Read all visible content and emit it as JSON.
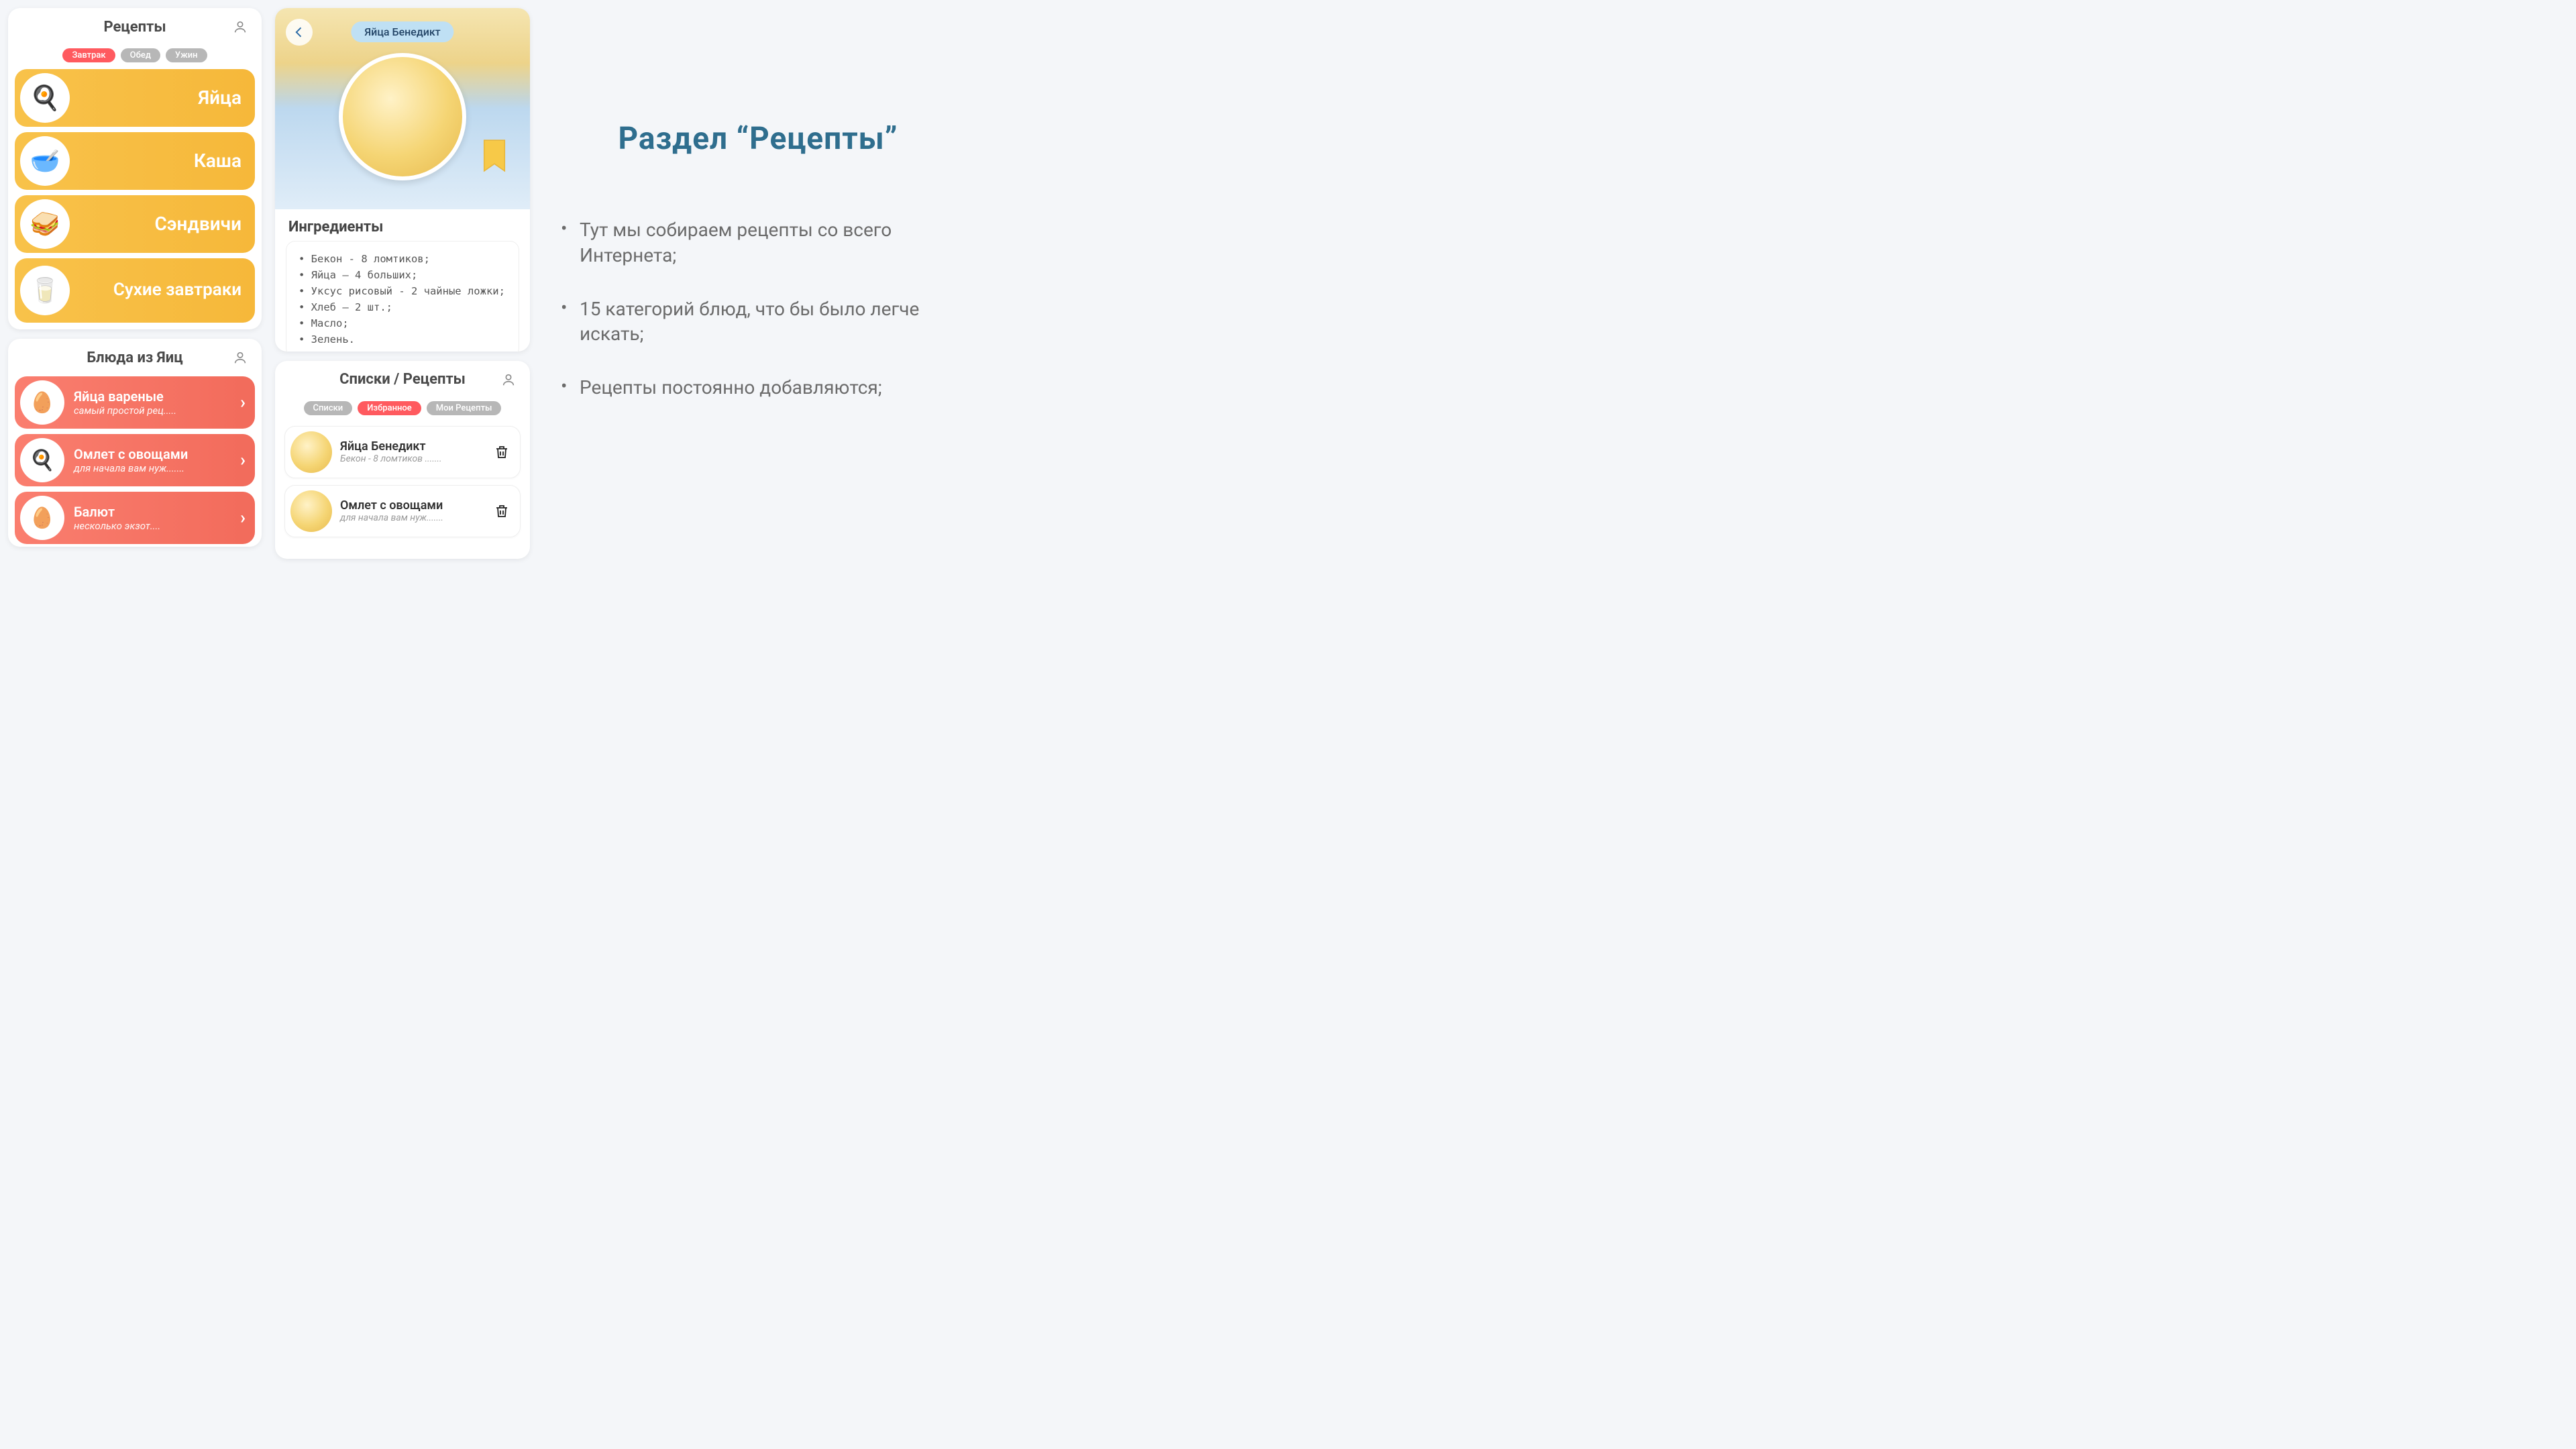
{
  "screens": {
    "recipes": {
      "title": "Рецепты",
      "filters": [
        {
          "label": "Завтрак",
          "active": true
        },
        {
          "label": "Обед",
          "active": false
        },
        {
          "label": "Ужин",
          "active": false
        }
      ],
      "categories": [
        {
          "label": "Яйца",
          "emoji": "🍳"
        },
        {
          "label": "Каша",
          "emoji": "🥣"
        },
        {
          "label": "Сэндвичи",
          "emoji": "🥪"
        },
        {
          "label": "Сухие завтраки",
          "emoji": "🥛"
        }
      ]
    },
    "recipe_detail": {
      "title": "Яйца Бенедикт",
      "ingredients_heading": "Ингредиенты",
      "ingredients": [
        "Бекон - 8 ломтиков;",
        "Яйца — 4 больших;",
        "Уксус рисовый - 2 чайные ложки;",
        "Хлеб — 2 шт.;",
        "Масло;",
        "Зелень."
      ]
    },
    "egg_dishes": {
      "title": "Блюда из Яиц",
      "items": [
        {
          "title": "Яйца вареные",
          "subtitle": "самый простой рец.....",
          "emoji": "🥚"
        },
        {
          "title": "Омлет с овощами",
          "subtitle": "для начала вам нуж.......",
          "emoji": "🍳"
        },
        {
          "title": "Балют",
          "subtitle": "несколько экзот....",
          "emoji": "🥚"
        }
      ]
    },
    "lists": {
      "title": "Списки / Рецепты",
      "tabs": [
        {
          "label": "Списки",
          "active": false
        },
        {
          "label": "Избранное",
          "active": true
        },
        {
          "label": "Мои Рецепты",
          "active": false
        }
      ],
      "favorites": [
        {
          "title": "Яйца Бенедикт",
          "subtitle": "Бекон - 8 ломтиков ......."
        },
        {
          "title": "Омлет с овощами",
          "subtitle": "для начала вам нуж......."
        }
      ]
    }
  },
  "info": {
    "section_title": "Раздел  “Рецепты”",
    "bullets": [
      "Тут мы собираем рецепты со всего Интернета;",
      "15 категорий блюд, что бы было легче искать;",
      "Рецепты постоянно добавляются;"
    ]
  }
}
